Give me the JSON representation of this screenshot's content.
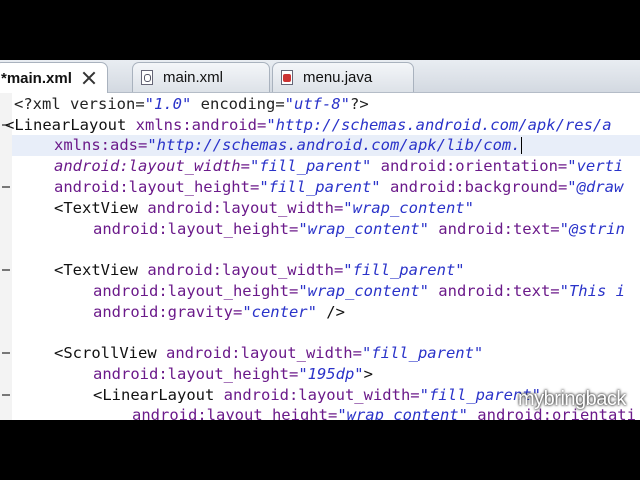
{
  "tabs": [
    {
      "label": "*main.xml",
      "active": true,
      "icon": "close-icon"
    },
    {
      "label": "main.xml",
      "active": false,
      "icon": "xml-file-icon"
    },
    {
      "label": "menu.java",
      "active": false,
      "icon": "java-file-icon"
    }
  ],
  "code": {
    "l1": {
      "a": "<?xml version=",
      "b": "\"1.0\"",
      "c": " encoding=",
      "d": "\"utf-8\"",
      "e": "?>"
    },
    "l2": {
      "a": "<LinearLayout ",
      "b": "xmlns:android=",
      "c": "\"http://schemas.android.com/apk/res/a"
    },
    "l3": {
      "a": "xmlns:ads=",
      "b": "\"http://schemas.android.com/apk/lib/com."
    },
    "l4": {
      "a": "android:layout_width=",
      "b": "\"fill_parent\"",
      "c": " android:orientation=",
      "d": "\"verti"
    },
    "l5": {
      "a": "android:layout_height=",
      "b": "\"fill_parent\"",
      "c": " android:background=",
      "d": "\"@draw"
    },
    "l6": {
      "a": "<TextView ",
      "b": "android:layout_width=",
      "c": "\"wrap_content\""
    },
    "l7": {
      "a": "android:layout_height=",
      "b": "\"wrap_content\"",
      "c": " android:text=",
      "d": "\"@strin"
    },
    "l9": {
      "a": "<TextView ",
      "b": "android:layout_width=",
      "c": "\"fill_parent\""
    },
    "l10": {
      "a": "android:layout_height=",
      "b": "\"wrap_content\"",
      "c": " android:text=",
      "d": "\"This i"
    },
    "l11": {
      "a": "android:gravity=",
      "b": "\"center\"",
      "c": " />"
    },
    "l13": {
      "a": "<ScrollView ",
      "b": "android:layout_width=",
      "c": "\"fill_parent\""
    },
    "l14": {
      "a": "android:layout_height=",
      "b": "\"195dp\"",
      "c": ">"
    },
    "l15": {
      "a": "<LinearLayout ",
      "b": "android:layout_width=",
      "c": "\"fill_parent\""
    },
    "l16": {
      "a": "android:layout_height=",
      "b": "\"wrap_content\"",
      "c": " android:orientati"
    }
  },
  "watermark": "mybringback",
  "colors": {
    "attribute": "#6b1a8a",
    "string": "#2a33c9",
    "highlight": "#e8eef9"
  }
}
